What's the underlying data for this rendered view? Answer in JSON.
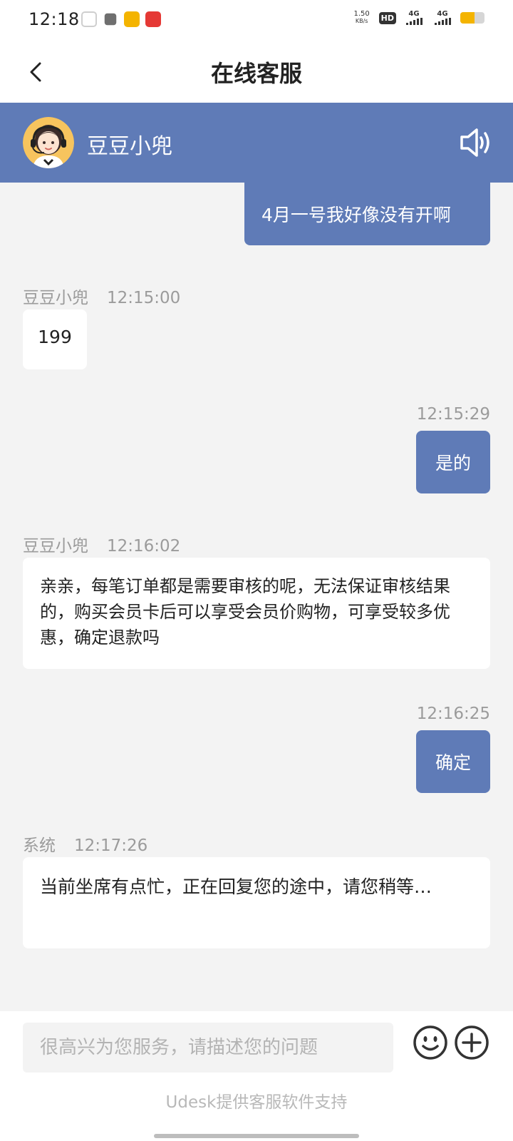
{
  "status_bar": {
    "time": "12:18",
    "net_speed_value": "1.50",
    "net_speed_unit": "KB/s",
    "hd_label": "HD",
    "sim1_label": "4G",
    "sim2_label": "4G",
    "battery_level": 0.6,
    "notification_icons": [
      "notification-icon",
      "storage-icon",
      "mail-icon",
      "app-icon"
    ]
  },
  "nav": {
    "title": "在线客服"
  },
  "agent": {
    "name": "豆豆小兜"
  },
  "messages": [
    {
      "from": "me",
      "sender": "",
      "time": "",
      "text": "4月一号我好像没有开啊"
    },
    {
      "from": "agent",
      "sender": "豆豆小兜",
      "time": "12:15:00",
      "text": "199"
    },
    {
      "from": "me",
      "sender": "",
      "time": "12:15:29",
      "text": "是的"
    },
    {
      "from": "agent",
      "sender": "豆豆小兜",
      "time": "12:16:02",
      "text": "亲亲，每笔订单都是需要审核的呢，无法保证审核结果的，购买会员卡后可以享受会员价购物，可享受较多优惠，确定退款吗"
    },
    {
      "from": "me",
      "sender": "",
      "time": "12:16:25",
      "text": "确定"
    },
    {
      "from": "system",
      "sender": "系统",
      "time": "12:17:26",
      "text": "当前坐席有点忙，正在回复您的途中，请您稍等…"
    }
  ],
  "input": {
    "placeholder": "很高兴为您服务，请描述您的问题"
  },
  "footer": {
    "powered_by": "Udesk提供客服软件支持"
  },
  "colors": {
    "accent": "#5f7bb7",
    "chat_background": "#f3f3f3",
    "meta_text": "#9b9b9b"
  }
}
